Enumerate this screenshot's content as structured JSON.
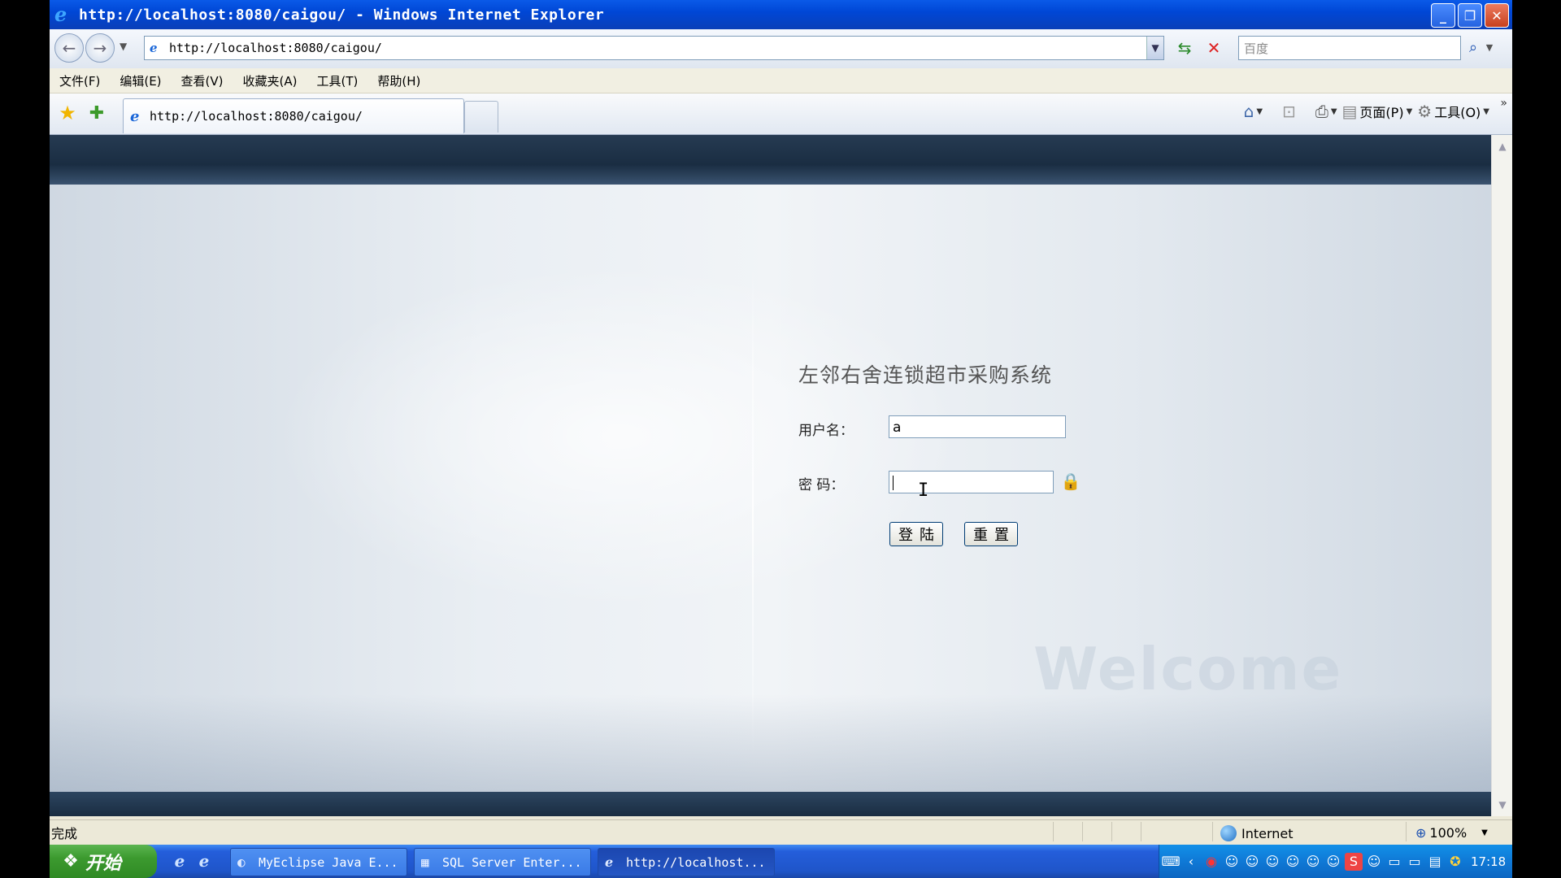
{
  "window": {
    "title": "http://localhost:8080/caigou/ - Windows Internet Explorer",
    "minimize": "_",
    "restore": "❐",
    "close": "✕"
  },
  "address_bar": {
    "url": "http://localhost:8080/caigou/",
    "search_placeholder": "百度"
  },
  "menu": {
    "items": [
      "文件(F)",
      "编辑(E)",
      "查看(V)",
      "收藏夹(A)",
      "工具(T)",
      "帮助(H)"
    ]
  },
  "tab": {
    "label": "http://localhost:8080/caigou/"
  },
  "command_bar": {
    "page_label": "页面(P)",
    "tools_label": "工具(O)"
  },
  "login": {
    "system_title": "左邻右舍连锁超市采购系统",
    "username_label": "用户名：",
    "username_value": "a",
    "password_label": "密 码：",
    "password_value": "",
    "login_button": "登陆",
    "reset_button": "重置",
    "welcome_text": "Welcome"
  },
  "status": {
    "text": "完成",
    "zone": "Internet",
    "zoom": "100%"
  },
  "taskbar": {
    "start_label": "开始",
    "tasks": [
      {
        "label": "MyEclipse Java E...",
        "icon": "eclipse-icon"
      },
      {
        "label": "SQL Server Enter...",
        "icon": "sql-server-icon"
      },
      {
        "label": "http://localhost...",
        "icon": "ie-icon"
      }
    ],
    "clock": "17:18"
  },
  "colors": {
    "title_bar": "#0a5ae8",
    "banner": "#1a2d42",
    "taskbar": "#245edb",
    "start_button": "#3c9a2f"
  }
}
